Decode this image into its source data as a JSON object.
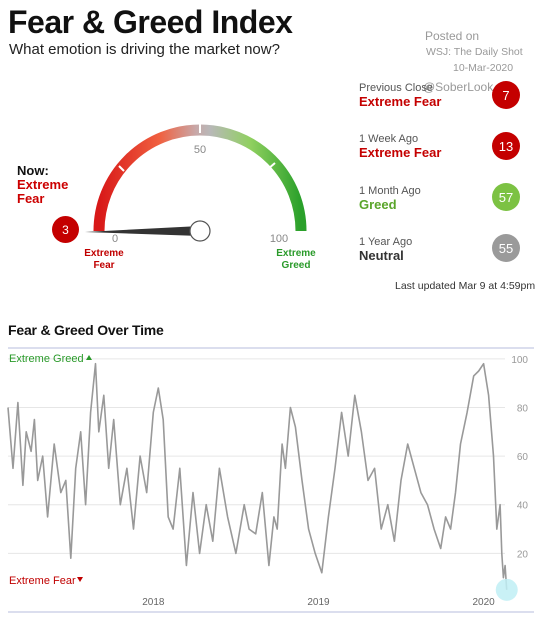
{
  "header": {
    "title": "Fear & Greed Index",
    "subtitle": "What emotion is driving the market now?",
    "posted_on": "Posted on",
    "source": "WSJ: The Daily Shot",
    "date": "10-Mar-2020",
    "handle": "@SoberLook"
  },
  "gauge": {
    "now_label": "Now:",
    "now_value": "Extreme Fear",
    "now_score": "3",
    "min_label": "0",
    "mid_label": "50",
    "max_label": "100",
    "left_caption": "Extreme Fear",
    "right_caption": "Extreme Greed",
    "score_value": 3
  },
  "history": [
    {
      "label": "Previous Close",
      "value": "Extreme Fear",
      "score": "7",
      "color": "#c40000"
    },
    {
      "label": "1 Week Ago",
      "value": "Extreme Fear",
      "score": "13",
      "color": "#c40000"
    },
    {
      "label": "1 Month Ago",
      "value": "Greed",
      "score": "57",
      "color": "#7cc243"
    },
    {
      "label": "1 Year Ago",
      "value": "Neutral",
      "score": "55",
      "color": "#9a9a9a"
    }
  ],
  "last_updated": "Last updated Mar 9 at 4:59pm",
  "colors": {
    "fear": "#c40000",
    "greed_text": "#2a9a2a",
    "line": "#999999",
    "highlight": "#bfeff5"
  },
  "chart_data": {
    "type": "line",
    "title": "Fear & Greed Over Time",
    "top_annotation": "Extreme Greed",
    "bottom_annotation": "Extreme Fear",
    "x_tick_labels": [
      "2018",
      "2019",
      "2020"
    ],
    "x_ticks": [
      2018.0,
      2019.0,
      2020.0
    ],
    "y_tick_labels": [
      "20",
      "40",
      "60",
      "80",
      "100"
    ],
    "y_ticks": [
      20,
      40,
      60,
      80,
      100
    ],
    "xlim": [
      2017.12,
      2020.19
    ],
    "ylim": [
      0,
      102
    ],
    "grid": true,
    "series": [
      {
        "x": [
          2017.12,
          2017.15,
          2017.18,
          2017.21,
          2017.23,
          2017.26,
          2017.28,
          2017.3,
          2017.33,
          2017.36,
          2017.4,
          2017.44,
          2017.47,
          2017.5,
          2017.53,
          2017.56,
          2017.59,
          2017.62,
          2017.65,
          2017.67,
          2017.7,
          2017.73,
          2017.76,
          2017.8,
          2017.84,
          2017.88,
          2017.92,
          2017.96,
          2018.0,
          2018.03,
          2018.06,
          2018.09,
          2018.12,
          2018.16,
          2018.2,
          2018.24,
          2018.28,
          2018.32,
          2018.36,
          2018.4,
          2018.45,
          2018.5,
          2018.55,
          2018.58,
          2018.62,
          2018.66,
          2018.7,
          2018.73,
          2018.75,
          2018.78,
          2018.8,
          2018.83,
          2018.86,
          2018.9,
          2018.94,
          2018.98,
          2019.02,
          2019.06,
          2019.1,
          2019.14,
          2019.18,
          2019.22,
          2019.26,
          2019.3,
          2019.34,
          2019.38,
          2019.42,
          2019.46,
          2019.5,
          2019.54,
          2019.58,
          2019.62,
          2019.66,
          2019.7,
          2019.74,
          2019.77,
          2019.8,
          2019.83,
          2019.86,
          2019.9,
          2019.94,
          2019.97,
          2020.0,
          2020.03,
          2020.06,
          2020.08,
          2020.1,
          2020.11,
          2020.12,
          2020.13,
          2020.14
        ],
        "y": [
          80,
          55,
          82,
          48,
          70,
          62,
          75,
          50,
          60,
          35,
          65,
          45,
          50,
          18,
          55,
          70,
          40,
          78,
          98,
          70,
          85,
          55,
          75,
          40,
          55,
          30,
          60,
          45,
          78,
          88,
          75,
          35,
          30,
          55,
          15,
          45,
          20,
          40,
          25,
          55,
          35,
          20,
          40,
          30,
          28,
          45,
          15,
          35,
          30,
          65,
          55,
          80,
          72,
          50,
          30,
          20,
          12,
          35,
          55,
          78,
          60,
          85,
          70,
          50,
          55,
          30,
          40,
          25,
          50,
          65,
          55,
          45,
          40,
          30,
          22,
          35,
          30,
          45,
          65,
          78,
          93,
          95,
          98,
          85,
          60,
          30,
          40,
          20,
          10,
          15,
          5
        ]
      }
    ]
  }
}
